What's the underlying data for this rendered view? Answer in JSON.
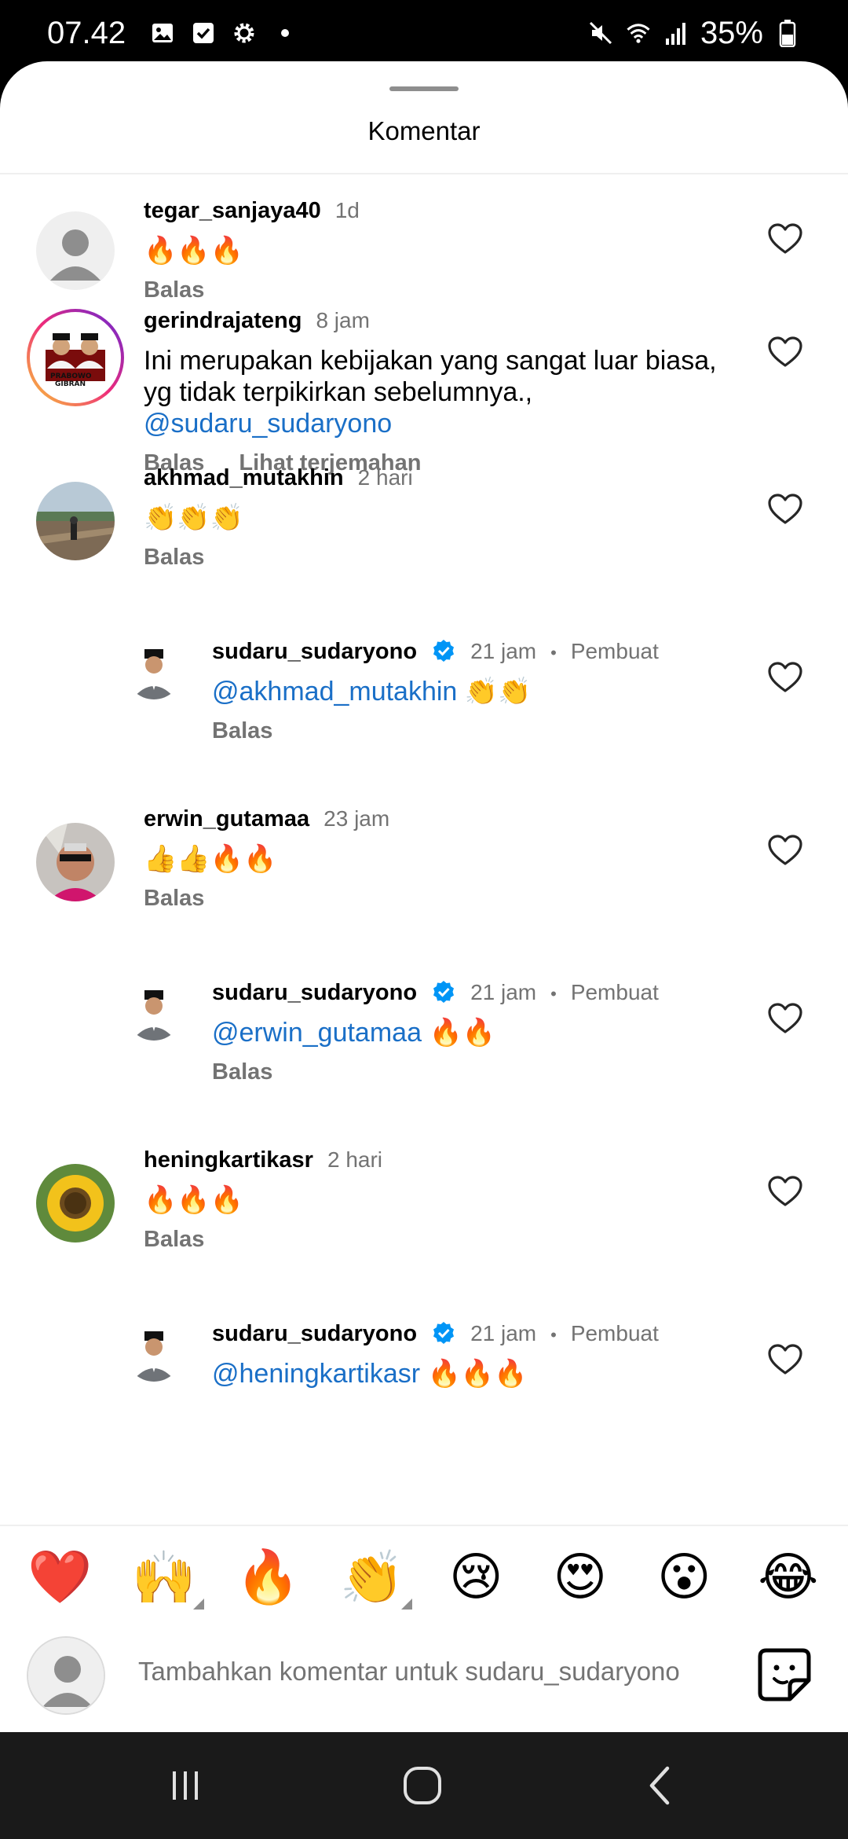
{
  "status_bar": {
    "time": "07.42",
    "battery": "35%",
    "icons": [
      "gallery-icon",
      "checkbox-icon",
      "settings-icon",
      "dot-icon",
      "mute-icon",
      "wifi-icon",
      "signal-icon",
      "battery-icon"
    ]
  },
  "sheet": {
    "title": "Komentar"
  },
  "comments": [
    {
      "username": "tegar_sanjaya40",
      "time": "1d",
      "text": "🔥🔥🔥",
      "reply_label": "Balas",
      "avatar": "default-avatar"
    },
    {
      "username": "gerindrajateng",
      "time": "8 jam",
      "text": "Ini merupakan kebijakan yang sangat luar biasa, yg tidak terpikirkan sebelumnya.,",
      "mention": "@sudaru_sudaryono",
      "reply_label": "Balas",
      "translate_label": "Lihat terjemahan",
      "avatar": "prabowo-gibran-avatar"
    },
    {
      "username": "akhmad_mutakhin",
      "time": "2 hari",
      "text": "👏👏👏",
      "reply_label": "Balas",
      "avatar": "landscape-avatar"
    },
    {
      "username": "sudaru_sudaryono",
      "time": "21 jam",
      "creator": "Pembuat",
      "mention": "@akhmad_mutakhin",
      "text": "👏👏",
      "reply_label": "Balas",
      "avatar": "man-peci-avatar"
    },
    {
      "username": "erwin_gutamaa",
      "time": "23 jam",
      "text": "👍👍🔥🔥",
      "reply_label": "Balas",
      "avatar": "selfie-avatar"
    },
    {
      "username": "sudaru_sudaryono",
      "time": "21 jam",
      "creator": "Pembuat",
      "mention": "@erwin_gutamaa",
      "text": "🔥🔥",
      "reply_label": "Balas",
      "avatar": "man-peci-avatar"
    },
    {
      "username": "heningkartikasr",
      "time": "2 hari",
      "text": "🔥🔥🔥",
      "reply_label": "Balas",
      "avatar": "sunflower-avatar"
    },
    {
      "username": "sudaru_sudaryono",
      "time": "21 jam",
      "creator": "Pembuat",
      "mention": "@heningkartikasr",
      "text": "🔥🔥🔥",
      "avatar": "man-peci-avatar"
    }
  ],
  "reactions": [
    "❤️",
    "🙌",
    "🔥",
    "👏",
    "😢",
    "😍",
    "😮",
    "😂"
  ],
  "composer": {
    "placeholder": "Tambahkan komentar untuk sudaru_sudaryono"
  },
  "colors": {
    "mention": "#1a6fc7",
    "verified": "#0095f6",
    "secondary_text": "#737373"
  }
}
